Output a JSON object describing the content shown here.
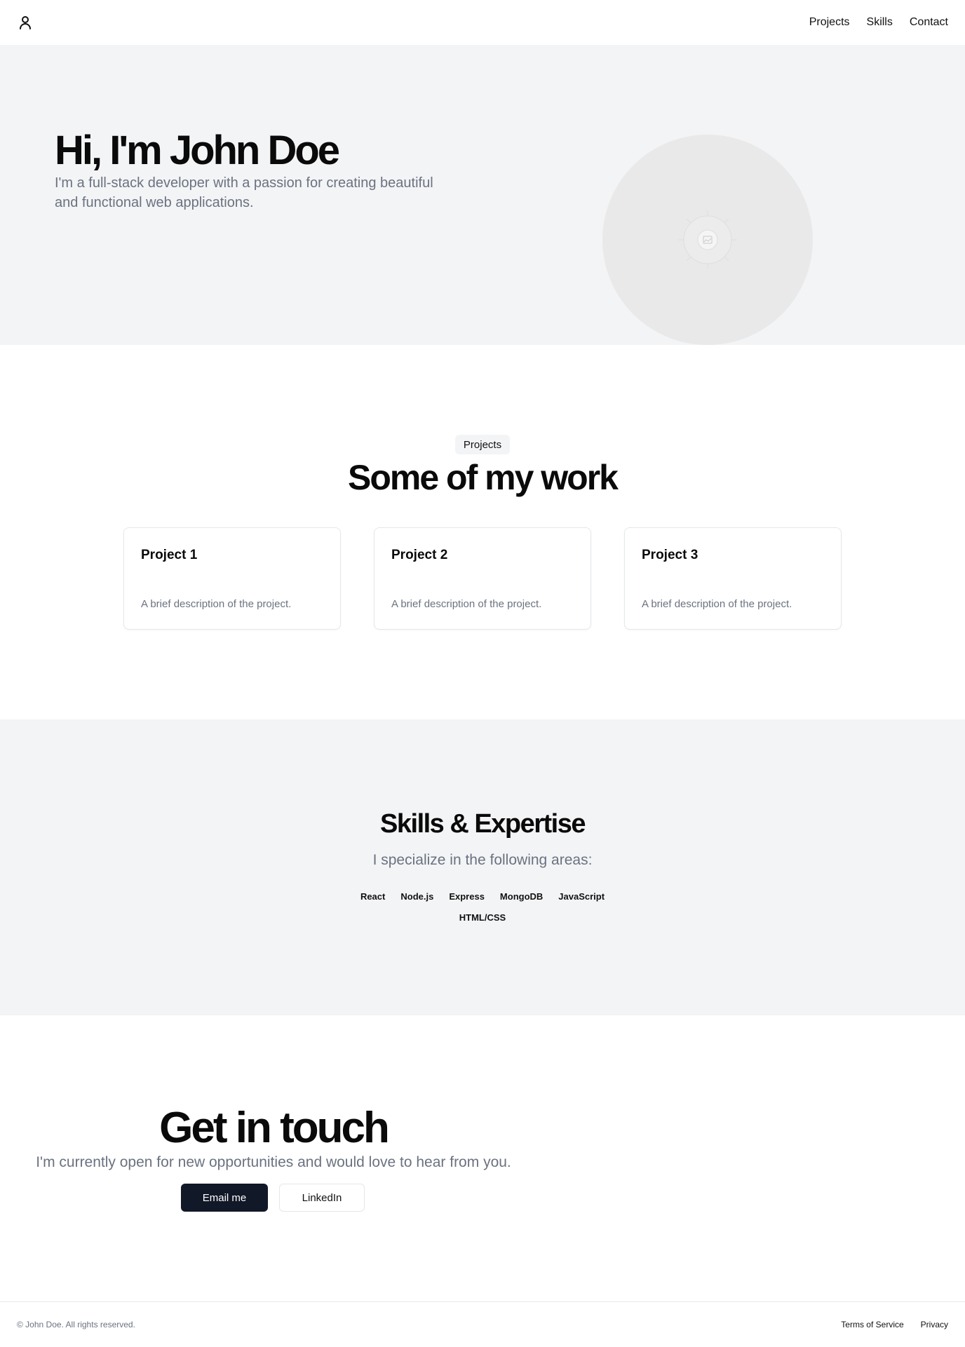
{
  "header": {
    "logo_icon": "user-icon",
    "nav": [
      {
        "label": "Projects"
      },
      {
        "label": "Skills"
      },
      {
        "label": "Contact"
      }
    ]
  },
  "hero": {
    "title": "Hi, I'm John Doe",
    "subtitle": "I'm a full-stack developer with a passion for creating beautiful and functional web applications.",
    "image_icon": "image-placeholder-icon"
  },
  "projects": {
    "pill": "Projects",
    "title": "Some of my work",
    "cards": [
      {
        "title": "Project 1",
        "description": "A brief description of the project."
      },
      {
        "title": "Project 2",
        "description": "A brief description of the project."
      },
      {
        "title": "Project 3",
        "description": "A brief description of the project."
      }
    ]
  },
  "skills": {
    "title": "Skills & Expertise",
    "subtitle": "I specialize in the following areas:",
    "items": [
      "React",
      "Node.js",
      "Express",
      "MongoDB",
      "JavaScript",
      "HTML/CSS"
    ]
  },
  "contact": {
    "title": "Get in touch",
    "subtitle": "I'm currently open for new opportunities and would love to hear from you.",
    "email_label": "Email me",
    "linkedin_label": "LinkedIn"
  },
  "footer": {
    "copyright": "© John Doe. All rights reserved.",
    "links": [
      {
        "label": "Terms of Service"
      },
      {
        "label": "Privacy"
      }
    ]
  },
  "colors": {
    "section_bg": "#f3f4f6",
    "muted_text": "#6b7280",
    "primary_button": "#111827",
    "border": "#e5e7eb"
  }
}
